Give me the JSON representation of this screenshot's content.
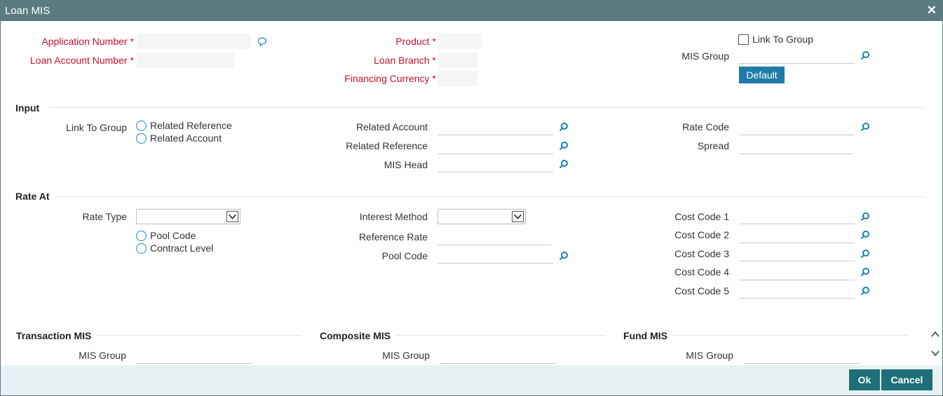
{
  "window": {
    "title": "Loan MIS",
    "close_icon": "✕"
  },
  "header": {
    "application_number": {
      "label": "Application Number",
      "required_mark": "*",
      "value": ""
    },
    "loan_account_number": {
      "label": "Loan Account Number",
      "required_mark": "*",
      "value": ""
    },
    "product": {
      "label": "Product",
      "required_mark": "*",
      "value": ""
    },
    "loan_branch": {
      "label": "Loan Branch",
      "required_mark": "*",
      "value": ""
    },
    "financing_currency": {
      "label": "Financing Currency",
      "required_mark": "*",
      "value": ""
    },
    "link_to_group": {
      "label": "Link To Group",
      "checked": false
    },
    "mis_group": {
      "label": "MIS Group",
      "value": ""
    },
    "default_button": "Default"
  },
  "input_section": {
    "title": "Input",
    "link_to_group_label": "Link To Group",
    "radio_options": [
      "Related Reference",
      "Related Account"
    ],
    "related_account": {
      "label": "Related Account",
      "value": ""
    },
    "related_reference": {
      "label": "Related Reference",
      "value": ""
    },
    "mis_head": {
      "label": "MIS Head",
      "value": ""
    },
    "rate_code": {
      "label": "Rate Code",
      "value": ""
    },
    "spread": {
      "label": "Spread",
      "value": ""
    }
  },
  "rate_at_section": {
    "title": "Rate At",
    "rate_type": {
      "label": "Rate Type",
      "value": ""
    },
    "radio_options": [
      "Pool Code",
      "Contract Level"
    ],
    "interest_method": {
      "label": "Interest Method",
      "value": ""
    },
    "reference_rate": {
      "label": "Reference Rate",
      "value": ""
    },
    "pool_code": {
      "label": "Pool Code",
      "value": ""
    },
    "cost_codes": [
      {
        "label": "Cost Code 1",
        "value": ""
      },
      {
        "label": "Cost Code 2",
        "value": ""
      },
      {
        "label": "Cost Code 3",
        "value": ""
      },
      {
        "label": "Cost Code 4",
        "value": ""
      },
      {
        "label": "Cost Code 5",
        "value": ""
      }
    ]
  },
  "mis_sections": {
    "transaction": {
      "title": "Transaction MIS",
      "mis_group_label": "MIS Group",
      "value": ""
    },
    "composite": {
      "title": "Composite MIS",
      "mis_group_label": "MIS Group",
      "value": ""
    },
    "fund": {
      "title": "Fund MIS",
      "mis_group_label": "MIS Group",
      "value": ""
    }
  },
  "footer": {
    "ok_label": "Ok",
    "cancel_label": "Cancel"
  },
  "colors": {
    "titlebar": "#5a7b80",
    "required": "#c8102e",
    "accent": "#1f7ba8",
    "footer_button": "#1e6f79",
    "lookup_icon": "#1a7fb5"
  }
}
